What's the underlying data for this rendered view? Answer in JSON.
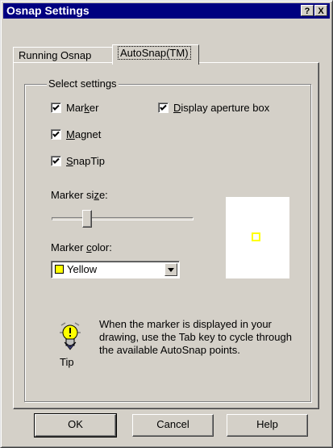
{
  "window": {
    "title": "Osnap Settings",
    "help_btn": "?",
    "close_btn": "X"
  },
  "tabs": [
    {
      "label": "Running Osnap",
      "active": false
    },
    {
      "label": "AutoSnap(TM)",
      "active": true
    }
  ],
  "group": {
    "label": "Select settings"
  },
  "checkboxes": {
    "marker": {
      "pre": "Mar",
      "u": "k",
      "post": "er",
      "checked": true
    },
    "magnet": {
      "pre": "",
      "u": "M",
      "post": "agnet",
      "checked": true
    },
    "snaptip": {
      "pre": "",
      "u": "S",
      "post": "napTip",
      "checked": true
    },
    "aperture": {
      "pre": "",
      "u": "D",
      "post": "isplay aperture box",
      "checked": true
    }
  },
  "marker_size": {
    "pre": "Marker si",
    "u": "z",
    "post": "e:",
    "level": 0.23
  },
  "marker_color": {
    "pre": "Marker ",
    "u": "c",
    "post": "olor:",
    "value": "Yellow",
    "swatch": "#ffff00"
  },
  "preview": {
    "marker_color": "#ffff00"
  },
  "tip": {
    "text": "When the marker is displayed in your drawing, use the Tab key to cycle through the available AutoSnap points.",
    "label": "Tip",
    "icon": "lightbulb-icon"
  },
  "buttons": {
    "ok": "OK",
    "cancel": "Cancel",
    "help": "Help"
  },
  "colors": {
    "titlebar": "#000080",
    "face": "#d4d0c8"
  }
}
